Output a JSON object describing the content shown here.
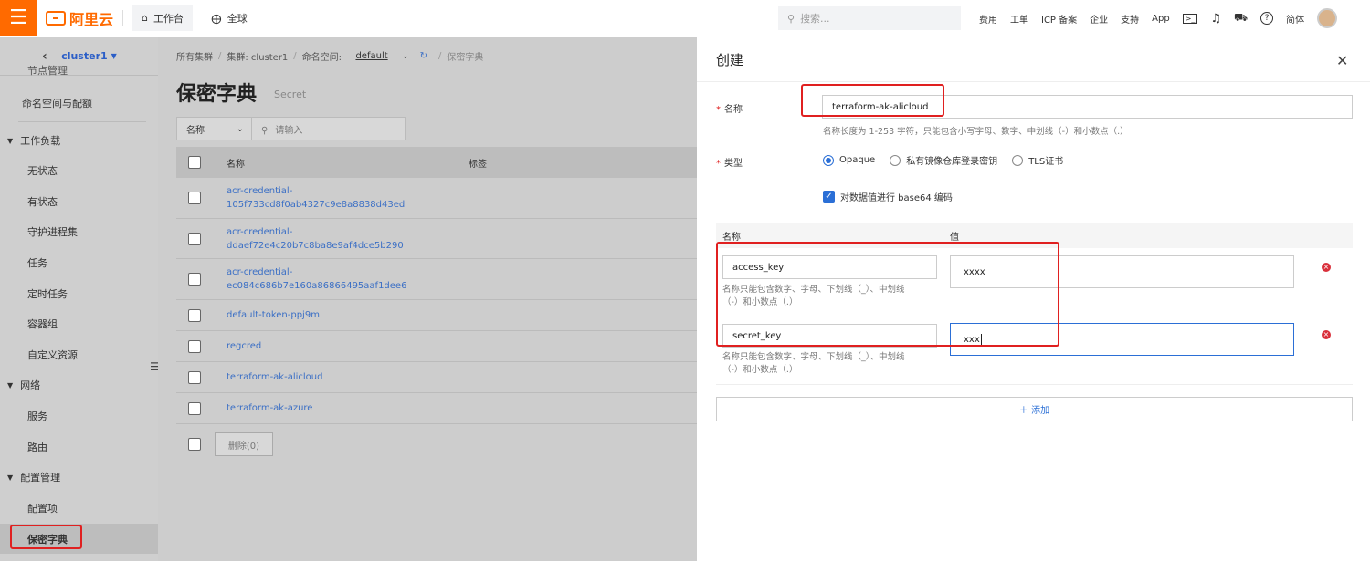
{
  "topbar": {
    "logo_text": "阿里云",
    "workbench": "工作台",
    "region": "全球",
    "search_placeholder": "搜索...",
    "nav": [
      "费用",
      "工单",
      "ICP 备案",
      "企业",
      "支持",
      "App"
    ],
    "lang": "简体"
  },
  "sidebar": {
    "cluster": "cluster1",
    "partial_top": "节点管理",
    "items": [
      {
        "label": "命名空间与配额",
        "kind": "sub"
      },
      {
        "label": "工作负载",
        "kind": "group"
      },
      {
        "label": "无状态",
        "kind": "sub"
      },
      {
        "label": "有状态",
        "kind": "sub"
      },
      {
        "label": "守护进程集",
        "kind": "sub"
      },
      {
        "label": "任务",
        "kind": "sub"
      },
      {
        "label": "定时任务",
        "kind": "sub"
      },
      {
        "label": "容器组",
        "kind": "sub"
      },
      {
        "label": "自定义资源",
        "kind": "sub"
      },
      {
        "label": "网络",
        "kind": "group"
      },
      {
        "label": "服务",
        "kind": "sub"
      },
      {
        "label": "路由",
        "kind": "sub"
      },
      {
        "label": "配置管理",
        "kind": "group"
      },
      {
        "label": "配置项",
        "kind": "sub"
      },
      {
        "label": "保密字典",
        "kind": "sub",
        "active": true
      }
    ]
  },
  "breadcrumb": {
    "all": "所有集群",
    "cluster": "集群: cluster1",
    "namespace_label": "命名空间:",
    "namespace": "default",
    "current": "保密字典"
  },
  "page": {
    "title": "保密字典",
    "subtitle": "Secret",
    "filter_select": "名称",
    "filter_placeholder": "请输入",
    "col_name": "名称",
    "col_tags": "标签",
    "rows": [
      {
        "l1": "acr-credential-",
        "l2": "105f733cd8f0ab4327c9e8a8838d43ed"
      },
      {
        "l1": "acr-credential-",
        "l2": "ddaef72e4c20b7c8ba8e9af4dce5b290"
      },
      {
        "l1": "acr-credential-",
        "l2": "ec084c686b7e160a86866495aaf1dee6"
      },
      {
        "l1": "default-token-ppj9m",
        "l2": ""
      },
      {
        "l1": "regcred",
        "l2": ""
      },
      {
        "l1": "terraform-ak-alicloud",
        "l2": ""
      },
      {
        "l1": "terraform-ak-azure",
        "l2": ""
      }
    ],
    "delete_label": "删除(0)"
  },
  "panel": {
    "title": "创建",
    "name_label": "名称",
    "name_value": "terraform-ak-alicloud",
    "name_hint": "名称长度为 1-253 字符，只能包含小写字母、数字、中划线（-）和小数点（.）",
    "type_label": "类型",
    "types": [
      "Opaque",
      "私有镜像仓库登录密钥",
      "TLS证书"
    ],
    "base64_label": "对数据值进行 base64 编码",
    "kv_col_name": "名称",
    "kv_col_value": "值",
    "kv": [
      {
        "key": "access_key",
        "value": "xxxx",
        "hint1": "名称只能包含数字、字母、下划线（_）、中划线",
        "hint2": "（-）和小数点（.）"
      },
      {
        "key": "secret_key",
        "value": "xxx",
        "hint1": "名称只能包含数字、字母、下划线（_）、中划线",
        "hint2": "（-）和小数点（.）"
      }
    ],
    "add_label": "＋ 添加"
  },
  "colors": {
    "accent": "#ff6a00",
    "link": "#3b6fc5",
    "highlight": "#e02020",
    "primary": "#2b6fd6"
  }
}
